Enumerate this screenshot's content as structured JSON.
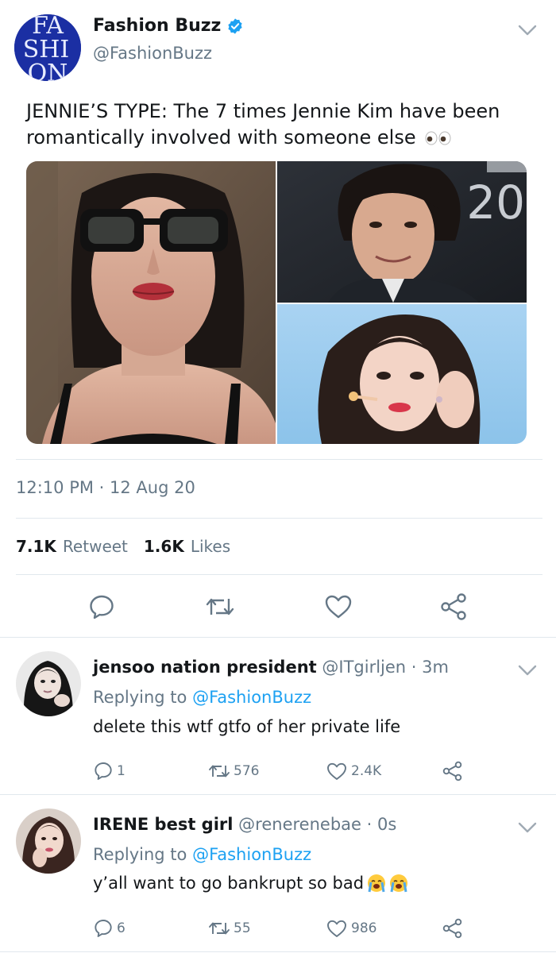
{
  "author": {
    "name": "Fashion Buzz",
    "handle": "@FashionBuzz",
    "avatar_logo_letters": "FASHION"
  },
  "tweet": {
    "text": "JENNIE’S TYPE: The 7 times Jennie Kim have been romantically involved with someone else",
    "emoji": "eyes",
    "image_overlay_text": "20",
    "timestamp": "12:10 PM · 12 Aug 20",
    "retweets_count": "7.1K",
    "retweets_label": "Retweet",
    "likes_count": "1.6K",
    "likes_label": "Likes"
  },
  "actions": {
    "icons": [
      "reply-icon",
      "retweet-icon",
      "like-icon",
      "share-icon"
    ]
  },
  "replies": [
    {
      "name": "jensoo nation president",
      "handle": "@ITgirljen",
      "time": "· 3m",
      "replying_prefix": "Replying to",
      "replying_to": "@FashionBuzz",
      "text": "delete this wtf gtfo of her private life",
      "emoji": "",
      "reply_count": "1",
      "retweet_count": "576",
      "like_count": "2.4K"
    },
    {
      "name": "IRENE best girl",
      "handle": "@renerenebae",
      "time": "· 0s",
      "replying_prefix": "Replying to",
      "replying_to": "@FashionBuzz",
      "text": "y’all want to go bankrupt so bad",
      "emoji": "loudly-crying-face x2",
      "reply_count": "6",
      "retweet_count": "55",
      "like_count": "986"
    }
  ],
  "colors": {
    "link": "#1da1f2",
    "muted": "#657786",
    "text": "#14171a",
    "divider": "#e1e8ed",
    "verified": "#1da1f2",
    "avatar_bg": "#1b2fa3"
  }
}
